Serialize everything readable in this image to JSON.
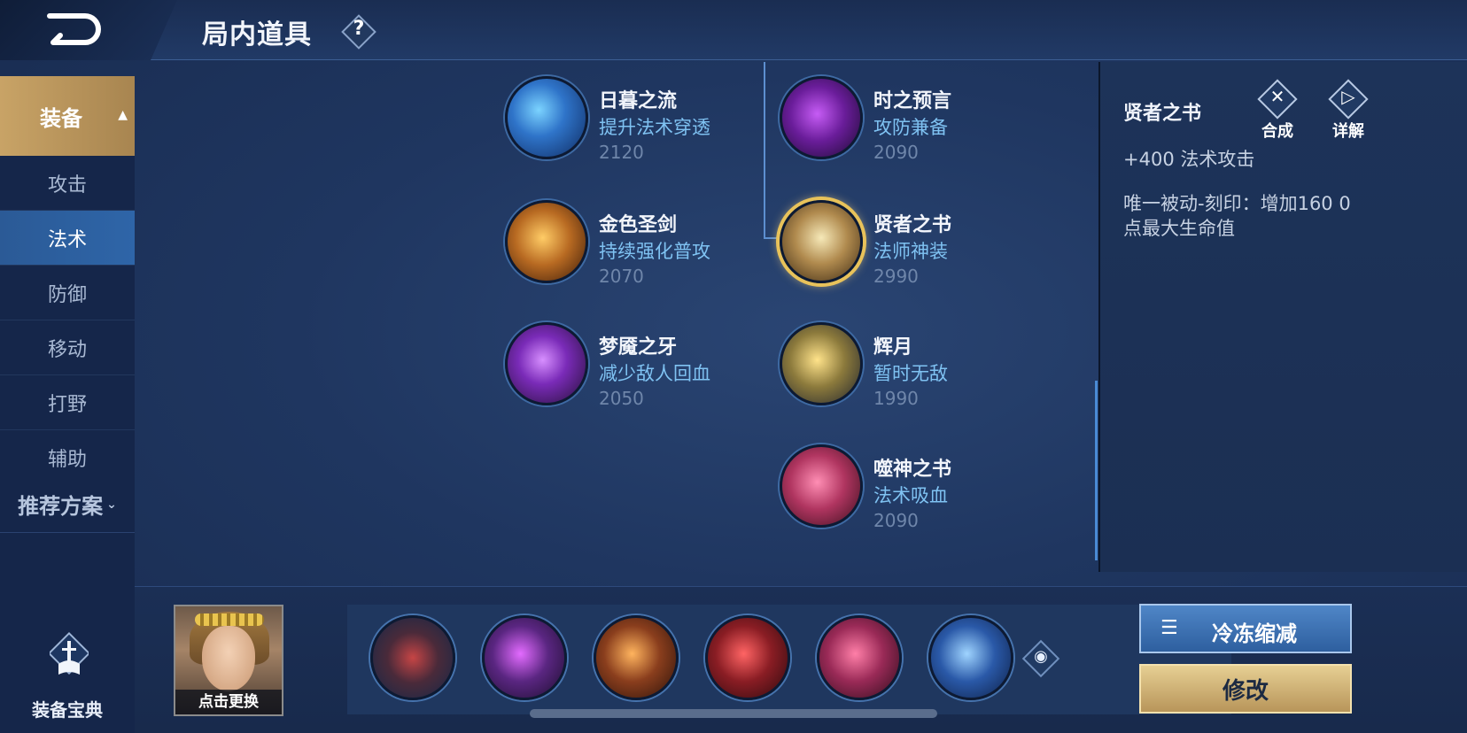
{
  "header": {
    "title": "局内道具",
    "help_icon": "?"
  },
  "sidebar": {
    "category": {
      "label": "装备"
    },
    "items": [
      {
        "label": "攻击"
      },
      {
        "label": "法术"
      },
      {
        "label": "防御"
      },
      {
        "label": "移动"
      },
      {
        "label": "打野"
      },
      {
        "label": "辅助"
      }
    ],
    "active_index": 1,
    "recommend_label": "推荐方案",
    "codex_label": "装备宝典"
  },
  "tree": {
    "items": [
      {
        "name": "日暮之流",
        "desc": "提升法术穿透",
        "price": "2120",
        "icon": "sunset-flow-icon"
      },
      {
        "name": "金色圣剑",
        "desc": "持续强化普攻",
        "price": "2070",
        "icon": "golden-sword-icon"
      },
      {
        "name": "梦魇之牙",
        "desc": "减少敌人回血",
        "price": "2050",
        "icon": "nightmare-fang-icon"
      },
      {
        "name": "时之预言",
        "desc": "攻防兼备",
        "price": "2090",
        "icon": "time-prophecy-icon"
      },
      {
        "name": "贤者之书",
        "desc": "法师神装",
        "price": "2990",
        "icon": "sage-book-icon",
        "selected": true
      },
      {
        "name": "辉月",
        "desc": "暂时无敌",
        "price": "1990",
        "icon": "radiant-moon-icon"
      },
      {
        "name": "噬神之书",
        "desc": "法术吸血",
        "price": "2090",
        "icon": "god-devour-book-icon"
      }
    ]
  },
  "detail": {
    "name": "贤者之书",
    "attribute": "+400 法术攻击",
    "passive": "唯一被动-刻印：增加160 0点最大生命值",
    "compose_label": "合成",
    "detail_label": "详解"
  },
  "bottom": {
    "hero_label": "点击更换",
    "slots": [
      "boots-icon",
      "axe-icon",
      "blade-icon",
      "red-spear-icon",
      "pink-spear-icon",
      "armor-icon"
    ],
    "cooldown_label": "冷冻缩减",
    "modify_label": "修改"
  },
  "colors": {
    "accent_gold": "#c8a366",
    "accent_blue": "#2e65a8",
    "desc_blue": "#7fc2f2"
  }
}
